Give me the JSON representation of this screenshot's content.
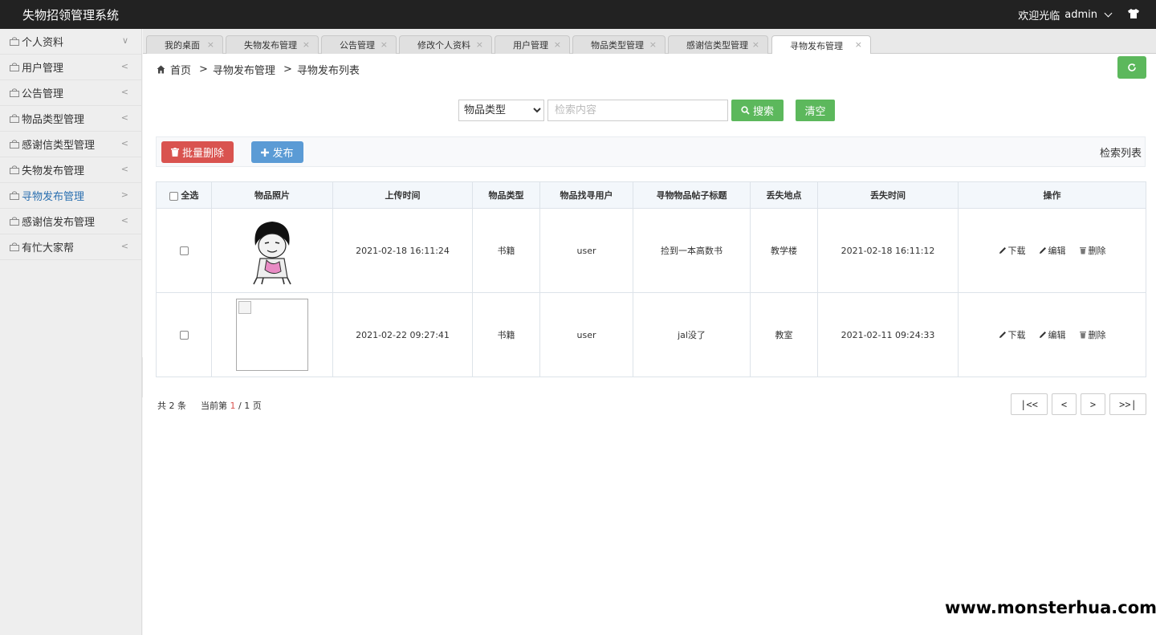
{
  "app": {
    "title": "失物招领管理系统",
    "welcome": "欢迎光临",
    "username": "admin"
  },
  "sidebar": {
    "items": [
      {
        "label": "个人资料",
        "arrow": "∨"
      },
      {
        "label": "用户管理",
        "arrow": "<"
      },
      {
        "label": "公告管理",
        "arrow": "<"
      },
      {
        "label": "物品类型管理",
        "arrow": "<"
      },
      {
        "label": "感谢信类型管理",
        "arrow": "<"
      },
      {
        "label": "失物发布管理",
        "arrow": "<"
      },
      {
        "label": "寻物发布管理",
        "arrow": ">"
      },
      {
        "label": "感谢信发布管理",
        "arrow": "<"
      },
      {
        "label": "有忙大家帮",
        "arrow": "<"
      }
    ],
    "active_index": 6
  },
  "tabs": [
    {
      "label": "我的桌面"
    },
    {
      "label": "失物发布管理"
    },
    {
      "label": "公告管理"
    },
    {
      "label": "修改个人资料"
    },
    {
      "label": "用户管理"
    },
    {
      "label": "物品类型管理"
    },
    {
      "label": "感谢信类型管理"
    },
    {
      "label": "寻物发布管理"
    }
  ],
  "tab_close": "×",
  "breadcrumb": {
    "home": "首页",
    "sep": ">",
    "level1": "寻物发布管理",
    "level2": "寻物发布列表"
  },
  "search": {
    "select_value": "物品类型",
    "placeholder": "检索内容",
    "search_label": "搜索",
    "clear_label": "清空"
  },
  "toolbar": {
    "batch_delete": "批量删除",
    "publish": "发布",
    "list_title": "检索列表"
  },
  "table": {
    "select_all": "全选",
    "headers": [
      "物品照片",
      "上传时间",
      "物品类型",
      "物品找寻用户",
      "寻物物品帖子标题",
      "丢失地点",
      "丢失时间",
      "操作"
    ],
    "rows": [
      {
        "upload_time": "2021-02-18 16:11:24",
        "type": "书籍",
        "user": "user",
        "title": "捡到一本高数书",
        "place": "教学楼",
        "lost_time": "2021-02-18 16:11:12"
      },
      {
        "upload_time": "2021-02-22 09:27:41",
        "type": "书籍",
        "user": "user",
        "title": "jal没了",
        "place": "教室",
        "lost_time": "2021-02-11 09:24:33"
      }
    ],
    "ops": {
      "download": "下载",
      "edit": "编辑",
      "delete": "删除"
    }
  },
  "pager": {
    "total": "共 2 条",
    "current_prefix": "当前第",
    "current": "1",
    "total_pages": "/ 1 页",
    "first": "|<<",
    "prev": "<",
    "next": ">",
    "last": ">>|"
  },
  "watermark": "www.monsterhua.com",
  "colors": {
    "topbar": "#222222",
    "green": "#5cb85c",
    "red": "#d9534f",
    "blue": "#5b9bd5",
    "active_link": "#2a6fb0"
  }
}
